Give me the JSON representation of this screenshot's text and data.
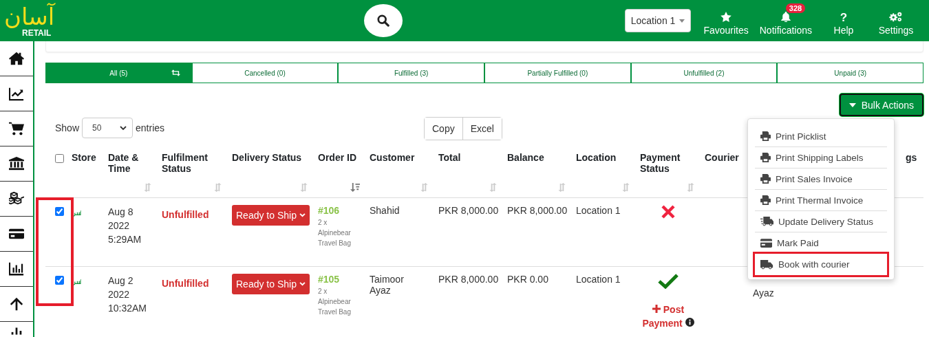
{
  "header": {
    "logo": {
      "script": "آسان",
      "word": "RETAIL"
    },
    "location_select": {
      "value": "Location 1"
    },
    "nav": [
      {
        "kind": "star",
        "label": "Favourites"
      },
      {
        "kind": "bell",
        "label": "Notifications",
        "badge": "328"
      },
      {
        "kind": "help",
        "label": "Help",
        "glyph": "?"
      },
      {
        "kind": "gears",
        "label": "Settings"
      }
    ]
  },
  "sidebar": {
    "items": [
      {
        "kind": "home"
      },
      {
        "kind": "chart"
      },
      {
        "kind": "cart"
      },
      {
        "kind": "bank"
      },
      {
        "kind": "cubes"
      },
      {
        "kind": "card"
      },
      {
        "kind": "bars"
      },
      {
        "kind": "upload"
      },
      {
        "kind": "download"
      }
    ]
  },
  "tabs": [
    {
      "label": "All (5)",
      "selected": true,
      "refresh_icon": true
    },
    {
      "label": "Cancelled (0)",
      "selected": false,
      "refresh_icon": false
    },
    {
      "label": "Fulfilled (3)",
      "selected": false,
      "refresh_icon": false
    },
    {
      "label": "Partially Fulfilled (0)",
      "selected": false,
      "refresh_icon": false
    },
    {
      "label": "Unfulfilled (2)",
      "selected": false,
      "refresh_icon": false
    },
    {
      "label": "Unpaid (3)",
      "selected": false,
      "refresh_icon": false
    }
  ],
  "bulk_actions": {
    "label": "Bulk Actions",
    "expanded": true,
    "menu": [
      {
        "kind": "print",
        "label": "Print Picklist",
        "highlighted": false
      },
      {
        "kind": "print",
        "label": "Print Shipping Labels",
        "highlighted": false
      },
      {
        "kind": "print",
        "label": "Print Sales Invoice",
        "highlighted": false
      },
      {
        "kind": "print",
        "label": "Print Thermal Invoice",
        "highlighted": false
      },
      {
        "kind": "delivery",
        "label": "Update Delivery Status",
        "highlighted": false
      },
      {
        "kind": "payment",
        "label": "Mark Paid",
        "highlighted": false
      },
      {
        "kind": "courier",
        "label": "Book with courier",
        "highlighted": true
      }
    ]
  },
  "length_control": {
    "before": "Show",
    "value": "50",
    "after": "entries"
  },
  "export_buttons": [
    "Copy",
    "Excel"
  ],
  "table": {
    "select_all": {
      "checked": false
    },
    "highlight_checkboxes": true,
    "columns": [
      {
        "label": "Store",
        "kind": "plain"
      },
      {
        "label": "Date & Time",
        "kind": "sortable"
      },
      {
        "label": "Fulfilment Status",
        "kind": "sortable"
      },
      {
        "label": "Delivery Status",
        "kind": "sortable"
      },
      {
        "label": "Order ID",
        "kind": "sorted"
      },
      {
        "label": "Customer",
        "kind": "sortable"
      },
      {
        "label": "Total",
        "kind": "sortable"
      },
      {
        "label": "Balance",
        "kind": "sortable"
      },
      {
        "label": "Location",
        "kind": "sortable"
      },
      {
        "label": "Payment Status",
        "kind": "sortable"
      },
      {
        "label": "Courier",
        "kind": "plain"
      },
      {
        "kind": "plain"
      },
      {
        "label": "gs",
        "kind": "plain"
      }
    ],
    "rows": [
      {
        "checked": true,
        "date": [
          "Aug 8",
          "2022",
          "5:29AM"
        ],
        "fulfilment": "Unfulfilled",
        "delivery": "Ready to Ship",
        "order_id": "#106",
        "items": "2 x Alpinebear Travel Bag",
        "customer": "Shahid",
        "total": "PKR 8,000.00",
        "balance": "PKR 8,000.00",
        "location": "Location 1",
        "payment": {
          "kind": "unpaid"
        }
      },
      {
        "checked": true,
        "date": [
          "Aug 2",
          "2022",
          "10:32AM"
        ],
        "fulfilment": "Unfulfilled",
        "delivery": "Ready to Ship",
        "order_id": "#105",
        "items": "2 x Alpinebear Travel Bag",
        "customer": "Taimoor Ayaz",
        "total": "PKR 8,000.00",
        "balance": "PKR 0.00",
        "location": "Location 1",
        "payment": {
          "kind": "paid",
          "action": "Post Payment"
        },
        "column_12": "Ayaz"
      }
    ]
  }
}
